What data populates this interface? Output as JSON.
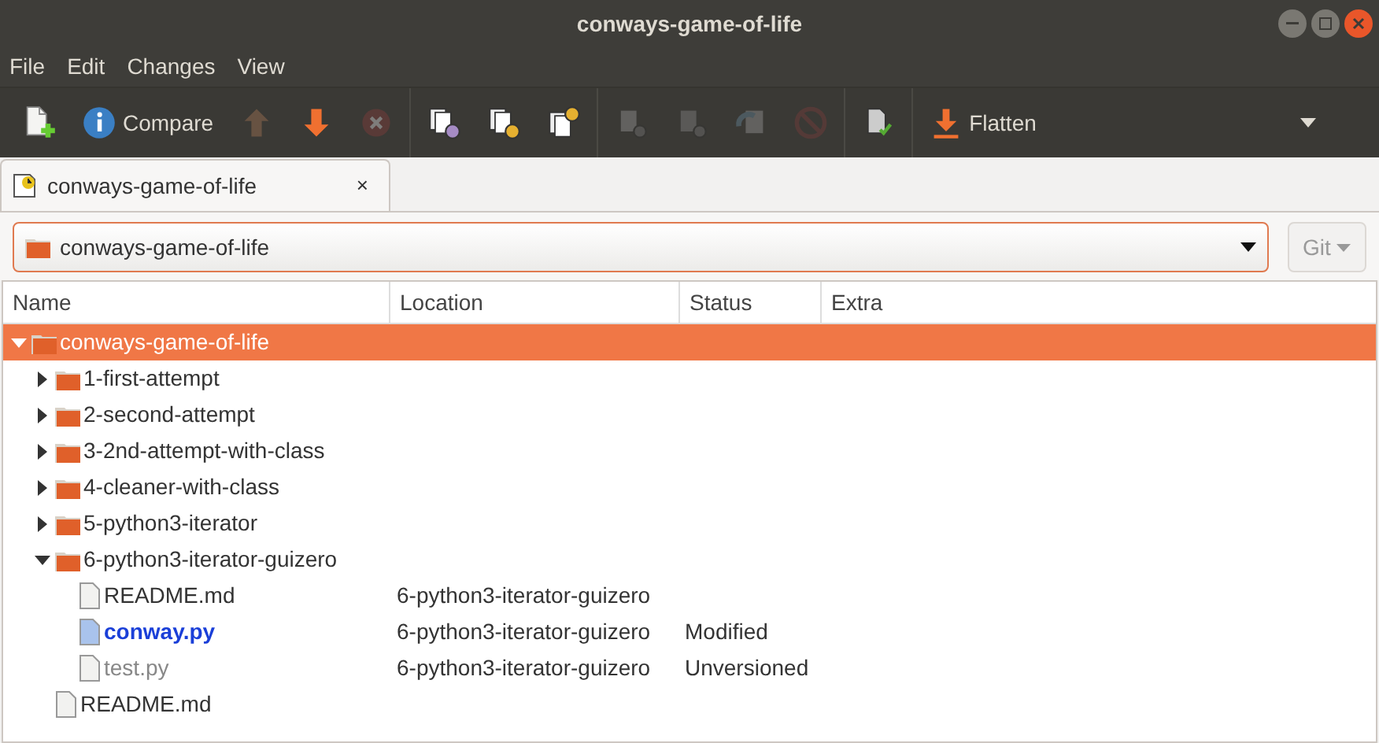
{
  "window": {
    "title": "conways-game-of-life"
  },
  "menu": [
    "File",
    "Edit",
    "Changes",
    "View"
  ],
  "toolbar": [
    [
      {
        "disabled": false
      },
      {
        "label": "Compare",
        "disabled": false
      },
      {
        "disabled": true
      },
      {
        "disabled": false
      },
      {
        "disabled": true
      }
    ],
    [
      {
        "disabled": false
      },
      {
        "disabled": false
      },
      {
        "disabled": false
      }
    ],
    [
      {
        "disabled": true
      },
      {
        "disabled": true
      },
      {
        "disabled": true
      },
      {
        "disabled": true
      }
    ],
    [
      {
        "disabled": false
      }
    ],
    [
      {
        "label": "Flatten",
        "disabled": false
      }
    ]
  ],
  "tabs": [
    {
      "label": "conways-game-of-life",
      "close": "×",
      "selected": true
    }
  ],
  "path": {
    "value": "conways-game-of-life"
  },
  "vcs": {
    "label": "Git",
    "disabled": true
  },
  "table": {
    "columns": [
      "Name",
      "Location",
      "Status",
      "Extra"
    ],
    "rows": [
      {
        "kind": "folder",
        "name": "conways-game-of-life",
        "expanded": true,
        "selected": true,
        "children": [
          {
            "kind": "folder",
            "name": "1-first-attempt",
            "expanded": false,
            "selected": false
          },
          {
            "kind": "folder",
            "name": "2-second-attempt",
            "expanded": false,
            "selected": false
          },
          {
            "kind": "folder",
            "name": "3-2nd-attempt-with-class",
            "expanded": false,
            "selected": false
          },
          {
            "kind": "folder",
            "name": "4-cleaner-with-class",
            "expanded": false,
            "selected": false
          },
          {
            "kind": "folder",
            "name": "5-python3-iterator",
            "expanded": false,
            "selected": false
          },
          {
            "kind": "folder",
            "name": "6-python3-iterator-guizero",
            "expanded": true,
            "selected": false,
            "children": [
              {
                "kind": "file",
                "name": "README.md",
                "location": "6-python3-iterator-guizero",
                "selected": false
              },
              {
                "kind": "modified",
                "name": "conway.py",
                "location": "6-python3-iterator-guizero",
                "status": "Modified",
                "selected": false
              },
              {
                "kind": "unversioned",
                "name": "test.py",
                "location": "6-python3-iterator-guizero",
                "status": "Unversioned",
                "selected": false
              }
            ]
          },
          {
            "kind": "file",
            "name": "README.md",
            "selected": false
          }
        ]
      }
    ]
  }
}
